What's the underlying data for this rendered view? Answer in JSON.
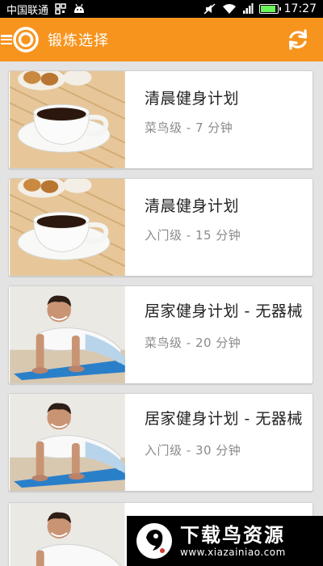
{
  "status_bar": {
    "carrier": "中国联通",
    "time": "17:27",
    "battery_level": 0.9
  },
  "app_bar": {
    "title": "锻炼选择",
    "accent_color": "#f7941e"
  },
  "workouts": [
    {
      "title": "清晨健身计划",
      "subtitle": "菜鸟级 - 7 分钟",
      "thumbnail": "coffee-cup"
    },
    {
      "title": "清晨健身计划",
      "subtitle": "入门级 - 15 分钟",
      "thumbnail": "coffee-cup"
    },
    {
      "title": "居家健身计划 - 无器械",
      "subtitle": "菜鸟级 - 20 分钟",
      "thumbnail": "pushup-man"
    },
    {
      "title": "居家健身计划 - 无器械",
      "subtitle": "入门级 - 30 分钟",
      "thumbnail": "pushup-man"
    },
    {
      "title": "",
      "subtitle": "",
      "thumbnail": "pushup-man"
    }
  ],
  "watermark": {
    "title": "下载鸟资源",
    "url": "www.xiazainiao.com"
  }
}
